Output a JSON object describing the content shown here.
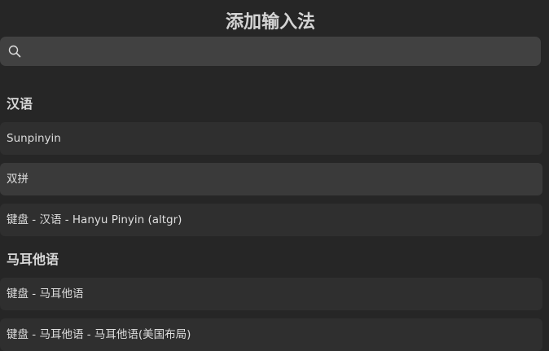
{
  "dialog": {
    "title": "添加输入法"
  },
  "search": {
    "placeholder": "",
    "value": ""
  },
  "sections": [
    {
      "header": "汉语",
      "items": [
        {
          "label": "Sunpinyin"
        },
        {
          "label": "双拼"
        },
        {
          "label": "键盘 - 汉语 - Hanyu Pinyin (altgr)"
        }
      ]
    },
    {
      "header": "马耳他语",
      "items": [
        {
          "label": "键盘 - 马耳他语"
        },
        {
          "label": "键盘 - 马耳他语 - 马耳他语(美国布局)"
        }
      ]
    }
  ],
  "colors": {
    "background": "#262626",
    "row": "#2f2f2f",
    "row_hover": "#3a3a3a",
    "search_bg": "#414141"
  },
  "icons": {
    "search": "search-icon"
  }
}
